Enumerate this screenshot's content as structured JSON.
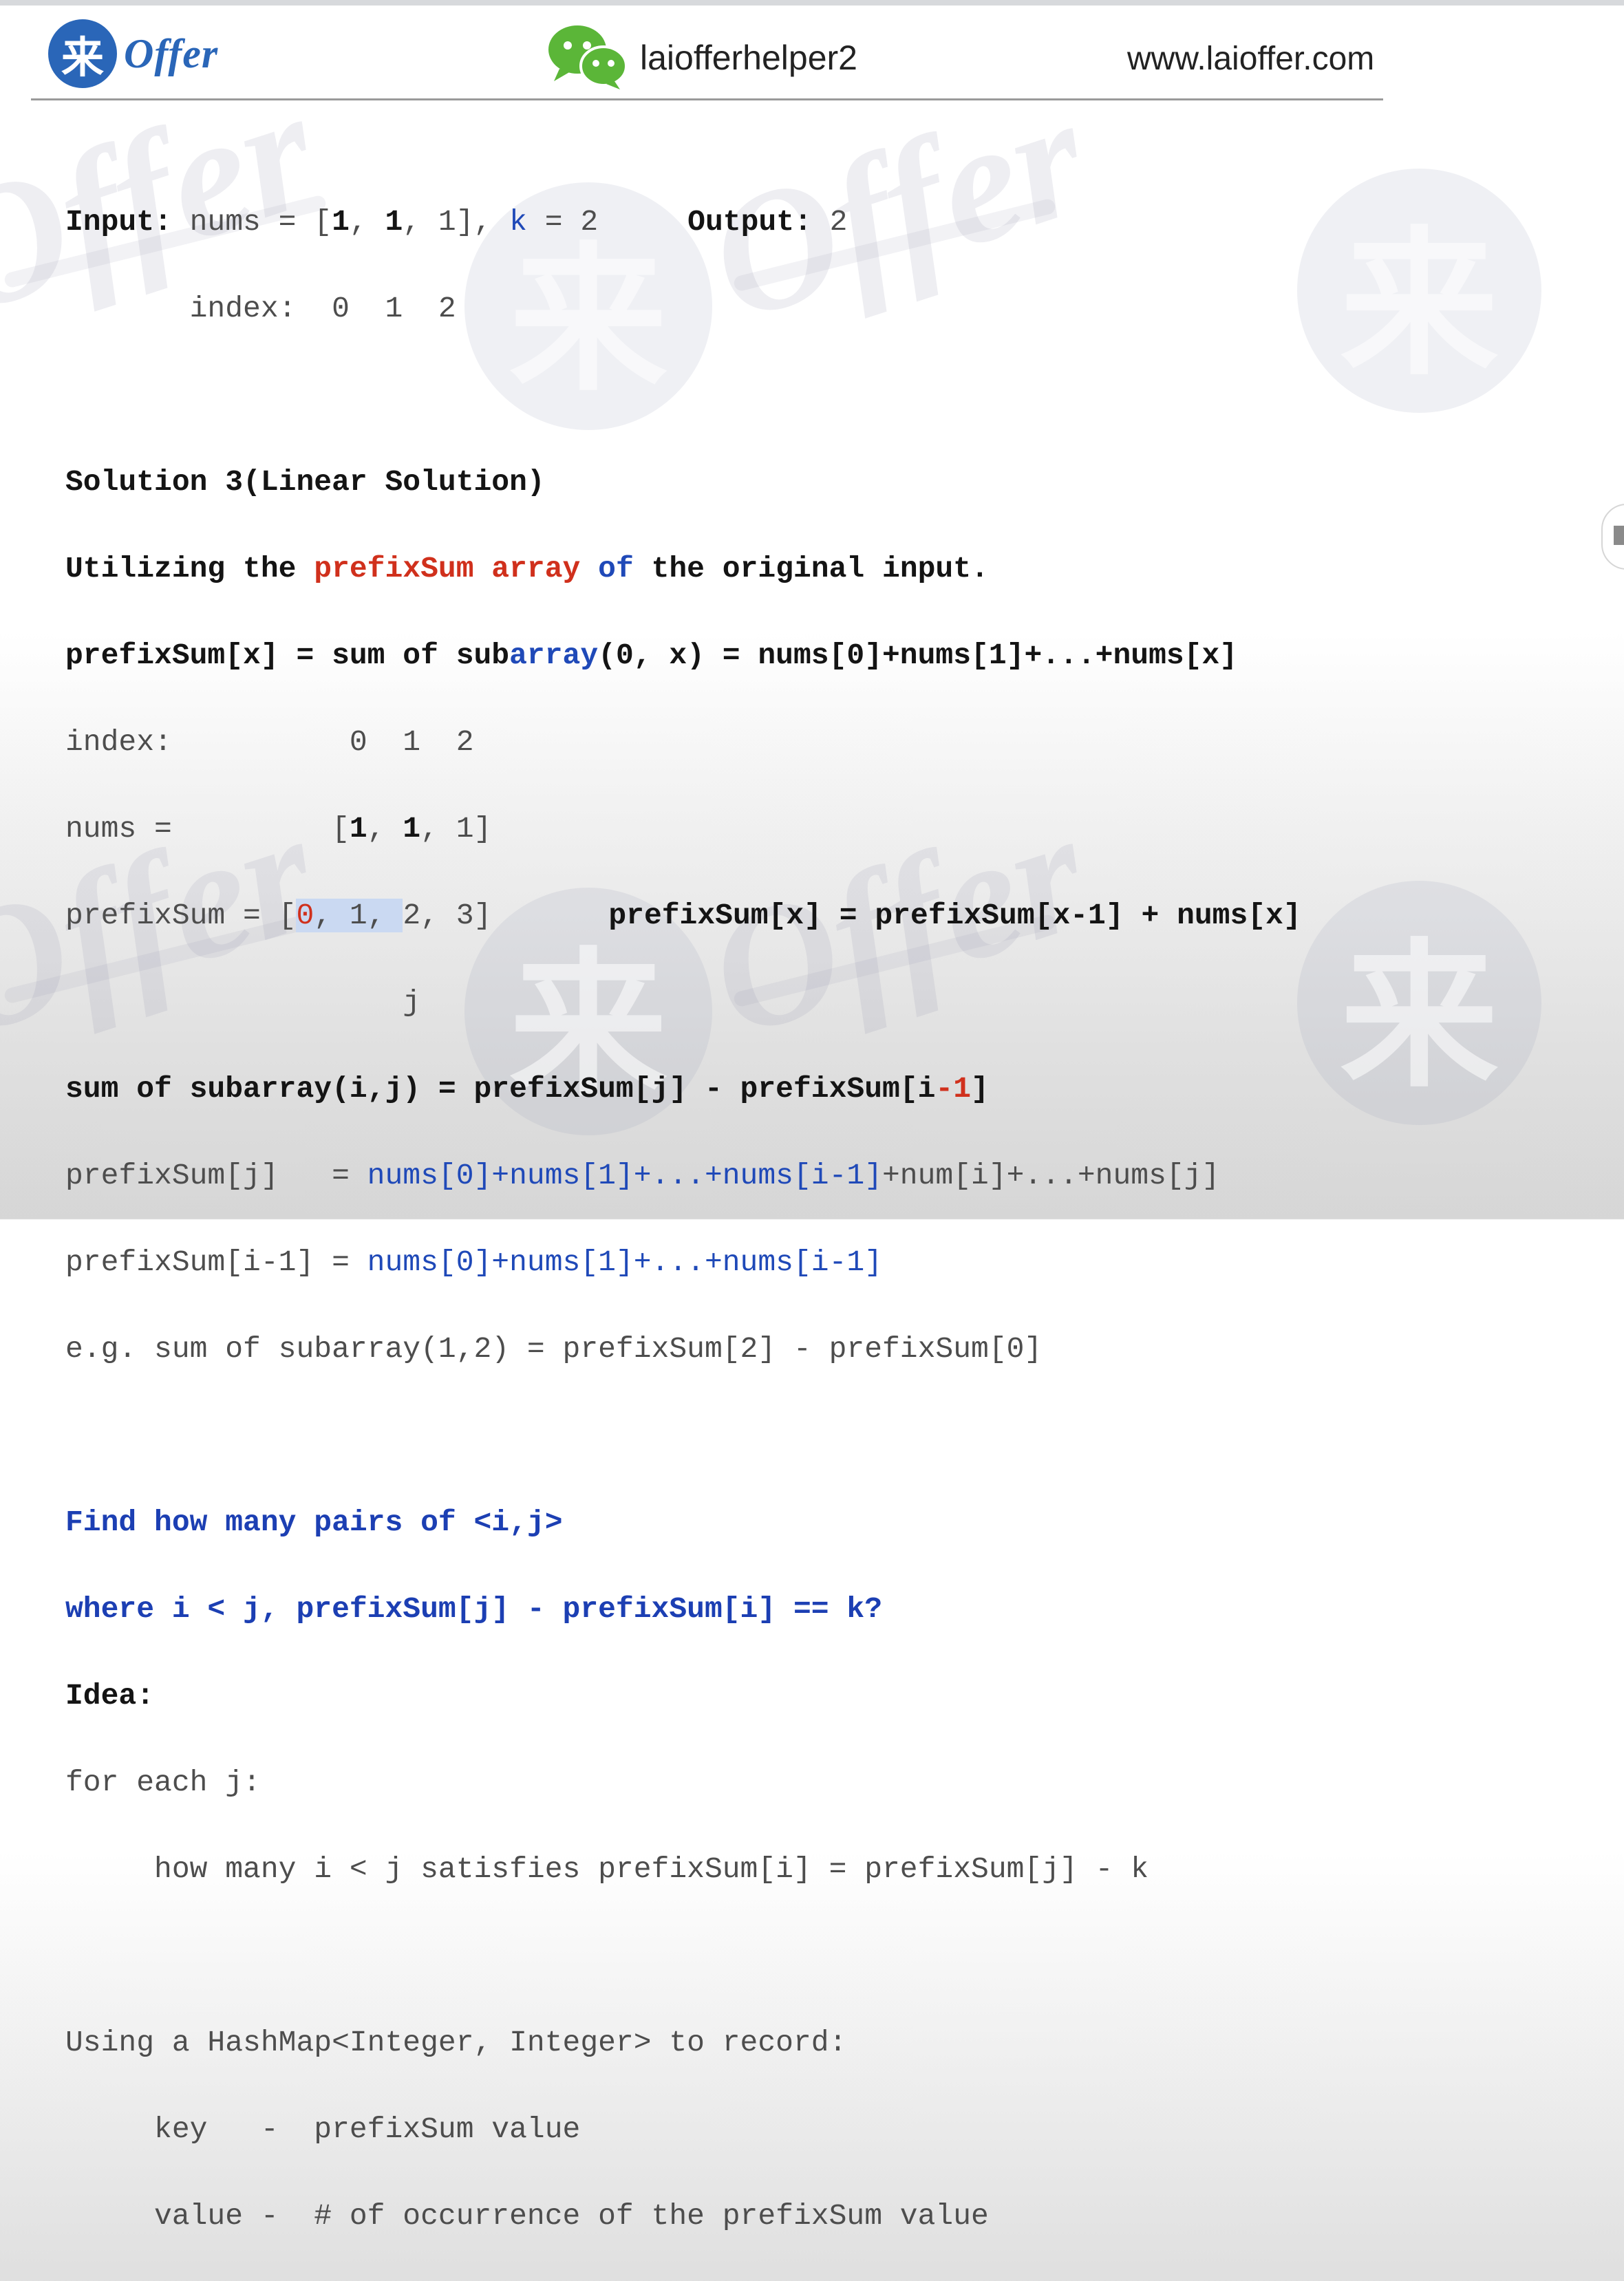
{
  "header": {
    "logo_char": "来",
    "logo_word": "Offer",
    "handle": "laiofferhelper2",
    "website": "www.laioffer.com"
  },
  "lines": {
    "input_label": "Input:",
    "input_nums_a": " nums = [",
    "input_one_1": "1",
    "input_sep_1": ", ",
    "input_one_2": "1",
    "input_sep_2": ", 1], ",
    "input_k": "k",
    "input_eq2": " = 2",
    "output_label": "Output:",
    "output_value": " 2",
    "index_row_1": "       index:  0  1  2",
    "sol_title": "Solution 3(Linear Solution)",
    "util_a": "Utilizing the ",
    "util_red": "prefixSum array",
    "util_of": " of",
    "util_b": " the original input.",
    "def_a": "prefixSum[x] = sum of sub",
    "def_blue": "array",
    "def_b": "(0, x) = nums[0]+nums[1]+...+nums[x]",
    "index_row_2": "index:          0  1  2",
    "nums_a": "nums =         [",
    "nums_one_1": "1",
    "nums_sep_1": ", ",
    "nums_one_2": "1",
    "nums_sep_2": ", 1]",
    "ps_a": "prefixSum = [",
    "ps_red0": "0",
    "ps_hl": ", 1, ",
    "ps_b": "2, 3]",
    "ps_formula": "prefixSum[x] = prefixSum[x-1] + nums[x]",
    "j_marker": "                   j",
    "sub_a": "sum of subarray(i,j) = prefixSum[j] - prefixSum[i",
    "sub_red": "-1",
    "sub_b": "]",
    "psj_label": "prefixSum[j]   = ",
    "psj_expr": "nums[0]+nums[1]+...+nums[i-1]",
    "psj_rest": "+num[i]+...+nums[j]",
    "psi_label": "prefixSum[i-1] = ",
    "psi_expr": "nums[0]+nums[1]+...+nums[i-1]",
    "eg": "e.g. sum of subarray(1,2) = prefixSum[2] - prefixSum[0]",
    "find_1": "Find how many pairs of <i,j>",
    "find_2": "where i < j, prefixSum[j] - prefixSum[i] == k?",
    "idea": "Idea:",
    "for_each": "for each j:",
    "how_many": "     how many i < j satisfies prefixSum[i] = prefixSum[j] - k",
    "using": "Using a HashMap<Integer, Integer> to record:",
    "key_line": "     key   -  prefixSum value",
    "value_line": "     value -  # of occurrence of the prefixSum value"
  },
  "watermark": {
    "word": "Offer",
    "char": "来"
  },
  "colors": {
    "brand": "#2a66b8",
    "blue_text": "#1c3fb3",
    "red_text": "#d0301c",
    "highlight": "#cad9f2",
    "wechat": "#5bb638"
  }
}
